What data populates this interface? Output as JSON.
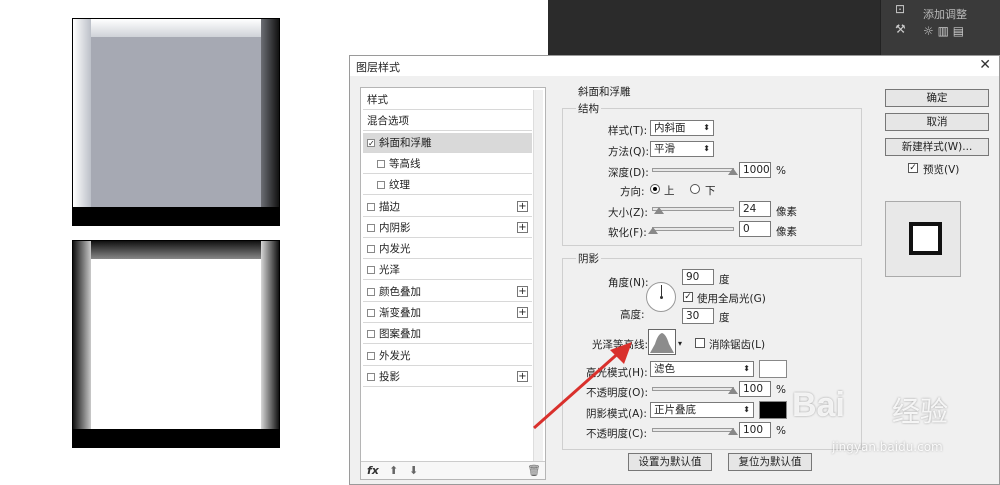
{
  "dark_panel": {
    "label": "添加调整"
  },
  "dialog": {
    "title": "图层样式",
    "close": "✕",
    "styles_list": [
      {
        "label": "样式",
        "checkbox": false,
        "plus": false,
        "selected": false,
        "indent": false
      },
      {
        "label": "混合选项",
        "checkbox": false,
        "plus": false,
        "selected": false,
        "indent": false
      },
      {
        "label": "斜面和浮雕",
        "checkbox": true,
        "checked": true,
        "plus": false,
        "selected": true,
        "indent": false
      },
      {
        "label": "等高线",
        "checkbox": true,
        "checked": false,
        "plus": false,
        "selected": false,
        "indent": true
      },
      {
        "label": "纹理",
        "checkbox": true,
        "checked": false,
        "plus": false,
        "selected": false,
        "indent": true
      },
      {
        "label": "描边",
        "checkbox": true,
        "checked": false,
        "plus": true,
        "selected": false,
        "indent": false
      },
      {
        "label": "内阴影",
        "checkbox": true,
        "checked": false,
        "plus": true,
        "selected": false,
        "indent": false
      },
      {
        "label": "内发光",
        "checkbox": true,
        "checked": false,
        "plus": false,
        "selected": false,
        "indent": false
      },
      {
        "label": "光泽",
        "checkbox": true,
        "checked": false,
        "plus": false,
        "selected": false,
        "indent": false
      },
      {
        "label": "颜色叠加",
        "checkbox": true,
        "checked": false,
        "plus": true,
        "selected": false,
        "indent": false
      },
      {
        "label": "渐变叠加",
        "checkbox": true,
        "checked": false,
        "plus": true,
        "selected": false,
        "indent": false
      },
      {
        "label": "图案叠加",
        "checkbox": true,
        "checked": false,
        "plus": false,
        "selected": false,
        "indent": false
      },
      {
        "label": "外发光",
        "checkbox": true,
        "checked": false,
        "plus": false,
        "selected": false,
        "indent": false
      },
      {
        "label": "投影",
        "checkbox": true,
        "checked": false,
        "plus": true,
        "selected": false,
        "indent": false
      }
    ],
    "footer": {
      "fx": "fx",
      "up": "⬆",
      "down": "⬇",
      "trash": "🗑"
    },
    "section_title": "斜面和浮雕",
    "structure": {
      "title": "结构",
      "style_label": "样式(T):",
      "style_value": "内斜面",
      "technique_label": "方法(Q):",
      "technique_value": "平滑",
      "depth_label": "深度(D):",
      "depth_value": "1000",
      "depth_unit": "%",
      "direction_label": "方向:",
      "dir_up": "上",
      "dir_down": "下",
      "size_label": "大小(Z):",
      "size_value": "24",
      "size_unit": "像素",
      "soften_label": "软化(F):",
      "soften_value": "0",
      "soften_unit": "像素"
    },
    "shading": {
      "title": "阴影",
      "angle_label": "角度(N):",
      "angle_value": "90",
      "angle_unit": "度",
      "global_light_label": "使用全局光(G)",
      "altitude_label": "高度:",
      "altitude_value": "30",
      "altitude_unit": "度",
      "gloss_contour_label": "光泽等高线:",
      "anti_alias_label": "消除锯齿(L)",
      "highlight_mode_label": "高光模式(H):",
      "highlight_mode_value": "滤色",
      "highlight_opacity_label": "不透明度(O):",
      "highlight_opacity_value": "100",
      "highlight_opacity_unit": "%",
      "shadow_mode_label": "阴影模式(A):",
      "shadow_mode_value": "正片叠底",
      "shadow_opacity_label": "不透明度(C):",
      "shadow_opacity_value": "100",
      "shadow_opacity_unit": "%",
      "highlight_color": "#ffffff",
      "shadow_color": "#000000"
    },
    "buttons": {
      "ok": "确定",
      "cancel": "取消",
      "new_style": "新建样式(W)...",
      "preview_label": "预览(V)",
      "set_default": "设置为默认值",
      "reset_default": "复位为默认值"
    }
  },
  "watermark": {
    "brand": "Bai",
    "brand2": "经验",
    "url": "jingyan.baidu.com"
  },
  "colors": {
    "arrow": "#d9302c",
    "dialog_bg": "#f0f0f0",
    "dark_bg": "#2b2b2b"
  }
}
